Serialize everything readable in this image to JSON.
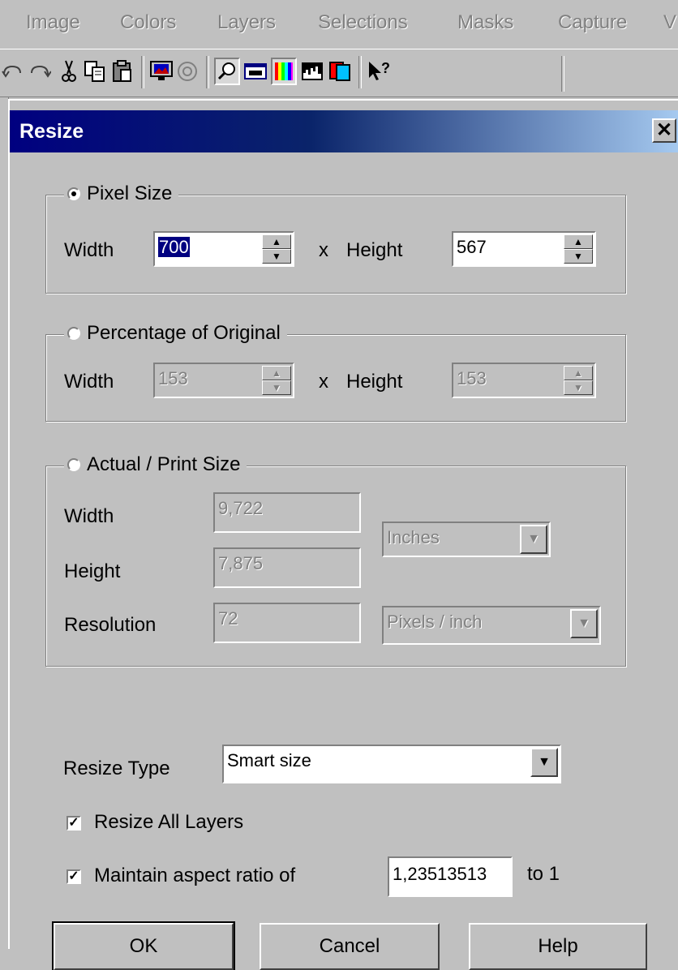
{
  "menu": {
    "items": [
      {
        "label": "Image",
        "key": "I"
      },
      {
        "label": "Colors",
        "key": "C"
      },
      {
        "label": "Layers",
        "key": "L"
      },
      {
        "label": "Selections",
        "key": "S"
      },
      {
        "label": "Masks",
        "key": "M"
      },
      {
        "label": "Capture",
        "key": "p"
      },
      {
        "label": "V",
        "key": ""
      }
    ]
  },
  "toolbar": {
    "icons": [
      "undo-icon",
      "redo-icon",
      "cut-icon",
      "copy-icon",
      "paste-icon",
      "monitor-icon",
      "browse-icon",
      "zoom-icon",
      "overview-icon",
      "color-palette-icon",
      "histogram-icon",
      "layers-icon",
      "context-help-icon"
    ]
  },
  "dialog": {
    "title": "Resize",
    "close_label": "✕",
    "pixel_size": {
      "label": "Pixel Size",
      "width_label": "Width",
      "width_value": "700",
      "x_label": "x",
      "height_label": "Height",
      "height_value": "567"
    },
    "percentage": {
      "label": "Percentage of Original",
      "width_label": "Width",
      "width_value": "153",
      "x_label": "x",
      "height_label": "Height",
      "height_value": "153"
    },
    "print_size": {
      "label": "Actual / Print Size",
      "width_label": "Width",
      "width_value": "9,722",
      "height_label": "Height",
      "height_value": "7,875",
      "resolution_label": "Resolution",
      "resolution_value": "72",
      "units_value": "Inches",
      "res_units_value": "Pixels / inch"
    },
    "resize_type": {
      "label": "Resize Type",
      "value": "Smart size"
    },
    "resize_all_layers": {
      "label": "Resize All Layers",
      "checked": true
    },
    "aspect": {
      "label": "Maintain aspect ratio of",
      "checked": true,
      "value": "1,23513513",
      "suffix": "to 1"
    },
    "buttons": {
      "ok": "OK",
      "cancel": "Cancel",
      "help": "Help"
    }
  }
}
